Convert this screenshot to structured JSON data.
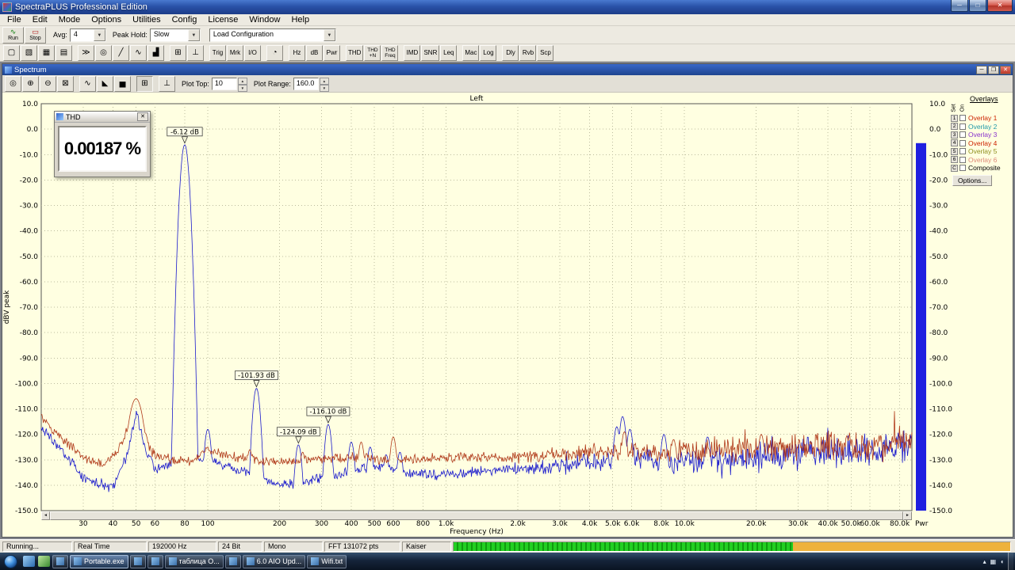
{
  "window": {
    "title": "SpectraPLUS Professional Edition"
  },
  "icons": {
    "minimize": "─",
    "maximize": "□",
    "close": "✕",
    "child_minimize": "─",
    "child_restore": "❐",
    "child_close": "✕",
    "combo_arrow": "▼",
    "spin_up": "▲",
    "spin_down": "▼",
    "scroll_left": "◄",
    "scroll_right": "►",
    "run_wave": "∿",
    "stop_wave": "▭",
    "thd_close": "✕"
  },
  "menu": {
    "items": [
      "File",
      "Edit",
      "Mode",
      "Options",
      "Utilities",
      "Config",
      "License",
      "Window",
      "Help"
    ]
  },
  "transport": {
    "run_label": "Run",
    "stop_label": "Stop",
    "avg_label": "Avg:",
    "avg_value": "4",
    "peak_hold_label": "Peak Hold:",
    "peak_hold_value": "Slow",
    "config_combo_value": "Load Configuration"
  },
  "toolbar": {
    "buttons": [
      {
        "name": "new-file-button",
        "glyph": "▢"
      },
      {
        "name": "open-file-button",
        "glyph": "▧"
      },
      {
        "name": "save-button",
        "glyph": "▦"
      },
      {
        "name": "print-button",
        "glyph": "▤"
      },
      {
        "sep": true
      },
      {
        "name": "jump-button",
        "glyph": "≫"
      },
      {
        "name": "zoom-tool-button",
        "glyph": "◎"
      },
      {
        "name": "phase-plot-button",
        "glyph": "╱"
      },
      {
        "name": "waveform-plot-button",
        "glyph": "∿"
      },
      {
        "name": "spectrogram-button",
        "glyph": "▟"
      },
      {
        "sep": true
      },
      {
        "name": "data-table-button",
        "glyph": "⊞"
      },
      {
        "name": "scale-button",
        "glyph": "⊥"
      },
      {
        "sep": true
      },
      {
        "name": "trigger-button",
        "label": "Trig"
      },
      {
        "name": "marker-button",
        "label": "Mrk"
      },
      {
        "name": "io-button",
        "label": "I/O"
      },
      {
        "sep": true
      },
      {
        "name": "timer-button",
        "glyph": "◔"
      },
      {
        "sep": true
      },
      {
        "name": "hz-button",
        "label": "Hz"
      },
      {
        "name": "db-button",
        "label": "dB"
      },
      {
        "name": "pwr-button",
        "label": "Pwr"
      },
      {
        "sep": true
      },
      {
        "name": "thd-button",
        "label": "THD"
      },
      {
        "name": "thd-n-button",
        "label": "THD|+N"
      },
      {
        "name": "thd-freq-button",
        "label": "THD|Freq"
      },
      {
        "sep": true
      },
      {
        "name": "imd-button",
        "label": "IMD"
      },
      {
        "name": "snr-button",
        "label": "SNR"
      },
      {
        "name": "leq-button",
        "label": "Leq"
      },
      {
        "sep": true
      },
      {
        "name": "macro-button",
        "label": "Mac"
      },
      {
        "name": "log-button",
        "label": "Log"
      },
      {
        "sep": true
      },
      {
        "name": "delay-button",
        "label": "Dly"
      },
      {
        "name": "reverb-button",
        "label": "Rvb"
      },
      {
        "name": "scope-button",
        "label": "Scp"
      }
    ]
  },
  "spectrum": {
    "title": "Spectrum",
    "toolbar": {
      "buttons": [
        {
          "name": "zoom-cursor-button",
          "glyph": "◎"
        },
        {
          "name": "zoom-in-button",
          "glyph": "⊕"
        },
        {
          "name": "zoom-out-button",
          "glyph": "⊖"
        },
        {
          "name": "zoom-reset-button",
          "glyph": "⊠"
        },
        {
          "sep": true
        },
        {
          "name": "line-plot-button",
          "glyph": "∿"
        },
        {
          "name": "filled-plot-button",
          "glyph": "◣"
        },
        {
          "name": "bar-plot-button",
          "glyph": "▅"
        },
        {
          "sep": true
        },
        {
          "name": "grid-toggle-button",
          "glyph": "⊞",
          "pressed": true
        },
        {
          "sep": true
        },
        {
          "name": "peak-cursor-button",
          "glyph": "⊥"
        }
      ],
      "plot_top_label": "Plot Top:",
      "plot_top_value": "10",
      "plot_range_label": "Plot Range:",
      "plot_range_value": "160.0"
    },
    "power_meter": {
      "label": "Pwr",
      "level_db": -5.5,
      "color": "#1f1fe0"
    }
  },
  "thd_meter": {
    "title": "THD",
    "value": "0.00187 %"
  },
  "overlays": {
    "header": "Overlays",
    "col_set": "Set",
    "col_on": "On",
    "items": [
      {
        "key": "1",
        "label": "Overlay 1",
        "color": "#cc2200"
      },
      {
        "key": "2",
        "label": "Overlay 2",
        "color": "#2299aa"
      },
      {
        "key": "3",
        "label": "Overlay 3",
        "color": "#8833cc"
      },
      {
        "key": "4",
        "label": "Overlay 4",
        "color": "#cc2200"
      },
      {
        "key": "5",
        "label": "Overlay 5",
        "color": "#8f8f20"
      },
      {
        "key": "6",
        "label": "Overlay 6",
        "color": "#dd8877"
      },
      {
        "key": "C",
        "label": "Composite",
        "color": "#000000"
      }
    ],
    "options_button": "Options..."
  },
  "status_bar": {
    "items": [
      "Running...",
      "Real Time",
      "192000 Hz",
      "24 Bit",
      "Mono",
      "FFT 131072 pts",
      "Kaiser"
    ],
    "meter": {
      "green_fraction": 0.61,
      "green_color": "#22cf22",
      "amber_color": "#eeb23c"
    }
  },
  "taskbar": {
    "items": [
      {
        "label": ""
      },
      {
        "label": "Portable.exe",
        "active": true
      },
      {
        "label": ""
      },
      {
        "label": ""
      },
      {
        "label": "таблица О..."
      },
      {
        "label": ""
      },
      {
        "label": "6.0 AIO Upd..."
      },
      {
        "label": "Wifi.txt"
      }
    ],
    "tray_icons": [
      {
        "name": "tray-expand-icon",
        "glyph": "▴"
      },
      {
        "name": "tray-network-icon",
        "glyph": "▦"
      },
      {
        "name": "tray-volume-icon",
        "glyph": "◖"
      }
    ]
  },
  "chart_data": {
    "type": "line",
    "title": "Left",
    "xlabel": "Frequency (Hz)",
    "ylabel": "dBV peak",
    "x_scale": "log",
    "x_range_hz": [
      20,
      90000
    ],
    "y_range_db": [
      -150,
      10
    ],
    "y_tick_step_db": 10,
    "y_ticks": [
      "10.0",
      "0.0",
      "-10.0",
      "-20.0",
      "-30.0",
      "-40.0",
      "-50.0",
      "-60.0",
      "-70.0",
      "-80.0",
      "-90.0",
      "-100.0",
      "-110.0",
      "-120.0",
      "-130.0",
      "-140.0",
      "-150.0"
    ],
    "x_ticks": [
      "30",
      "40",
      "50",
      "60",
      "80",
      "100",
      "200",
      "300",
      "400",
      "500",
      "600",
      "800",
      "1.0k",
      "2.0k",
      "3.0k",
      "4.0k",
      "5.0k",
      "6.0k",
      "8.0k",
      "10.0k",
      "20.0k",
      "30.0k",
      "40.0k",
      "50.0k",
      "60.0k",
      "80.0k"
    ],
    "x_tick_hz": [
      30,
      40,
      50,
      60,
      80,
      100,
      200,
      300,
      400,
      500,
      600,
      800,
      1000,
      2000,
      3000,
      4000,
      5000,
      6000,
      8000,
      10000,
      20000,
      30000,
      40000,
      50000,
      60000,
      80000
    ],
    "plot_bg": "#ffffe1",
    "grid_color": "#bcbc9e",
    "peak_annotations": [
      {
        "freq_hz": 80,
        "db": -6.12,
        "label": "-6.12 dB"
      },
      {
        "freq_hz": 160,
        "db": -101.93,
        "label": "-101.93 dB"
      },
      {
        "freq_hz": 320,
        "db": -116.1,
        "label": "-116.10 dB"
      },
      {
        "freq_hz": 240,
        "db": -124.09,
        "label": "-124.09 dB"
      }
    ],
    "series": [
      {
        "name": "left-channel-live",
        "color": "#1a1acc",
        "floor_anchors": [
          [
            20,
            -117
          ],
          [
            26,
            -130
          ],
          [
            30,
            -137
          ],
          [
            40,
            -141
          ],
          [
            46,
            -128
          ],
          [
            50,
            -112
          ],
          [
            55,
            -126
          ],
          [
            60,
            -134
          ],
          [
            70,
            -131
          ],
          [
            90,
            -130
          ],
          [
            110,
            -131
          ],
          [
            130,
            -134
          ],
          [
            160,
            -136
          ],
          [
            200,
            -140
          ],
          [
            260,
            -139
          ],
          [
            320,
            -136
          ],
          [
            420,
            -134
          ],
          [
            520,
            -133
          ],
          [
            700,
            -135
          ],
          [
            1000,
            -136
          ],
          [
            1600,
            -134
          ],
          [
            2500,
            -133
          ],
          [
            4000,
            -131
          ],
          [
            6000,
            -129
          ],
          [
            9000,
            -131
          ],
          [
            15000,
            -130
          ],
          [
            25000,
            -128
          ],
          [
            40000,
            -127
          ],
          [
            60000,
            -126
          ],
          [
            90000,
            -124
          ]
        ],
        "peaks": [
          [
            80,
            -6.12
          ],
          [
            100,
            -118
          ],
          [
            160,
            -101.93
          ],
          [
            240,
            -124.09
          ],
          [
            320,
            -116.1
          ],
          [
            400,
            -123
          ],
          [
            480,
            -125
          ],
          [
            560,
            -128
          ],
          [
            640,
            -127
          ],
          [
            5200,
            -117
          ],
          [
            5500,
            -113
          ],
          [
            5900,
            -118
          ],
          [
            8200,
            -120
          ],
          [
            12500,
            -121
          ]
        ],
        "jitter_db": 2.5,
        "jitter_hf_db": 5.5
      },
      {
        "name": "overlay-trace",
        "color": "#b03a1a",
        "floor_anchors": [
          [
            20,
            -113
          ],
          [
            24,
            -121
          ],
          [
            30,
            -129
          ],
          [
            36,
            -132
          ],
          [
            42,
            -127
          ],
          [
            50,
            -109
          ],
          [
            58,
            -127
          ],
          [
            70,
            -130
          ],
          [
            85,
            -131
          ],
          [
            100,
            -126
          ],
          [
            130,
            -129
          ],
          [
            180,
            -131
          ],
          [
            260,
            -130
          ],
          [
            400,
            -129
          ],
          [
            600,
            -130
          ],
          [
            1000,
            -129
          ],
          [
            2000,
            -129
          ],
          [
            4000,
            -127
          ],
          [
            8000,
            -127
          ],
          [
            15000,
            -126
          ],
          [
            30000,
            -125
          ],
          [
            60000,
            -124
          ],
          [
            90000,
            -122
          ]
        ],
        "peaks": [
          [
            50,
            -106,
            0.02
          ],
          [
            150,
            -126
          ],
          [
            250,
            -127
          ],
          [
            440,
            -123
          ],
          [
            600,
            -121
          ],
          [
            5600,
            -119
          ],
          [
            9000,
            -122
          ],
          [
            21000,
            -120
          ]
        ],
        "jitter_db": 2.2,
        "jitter_hf_db": 4.5
      }
    ]
  }
}
